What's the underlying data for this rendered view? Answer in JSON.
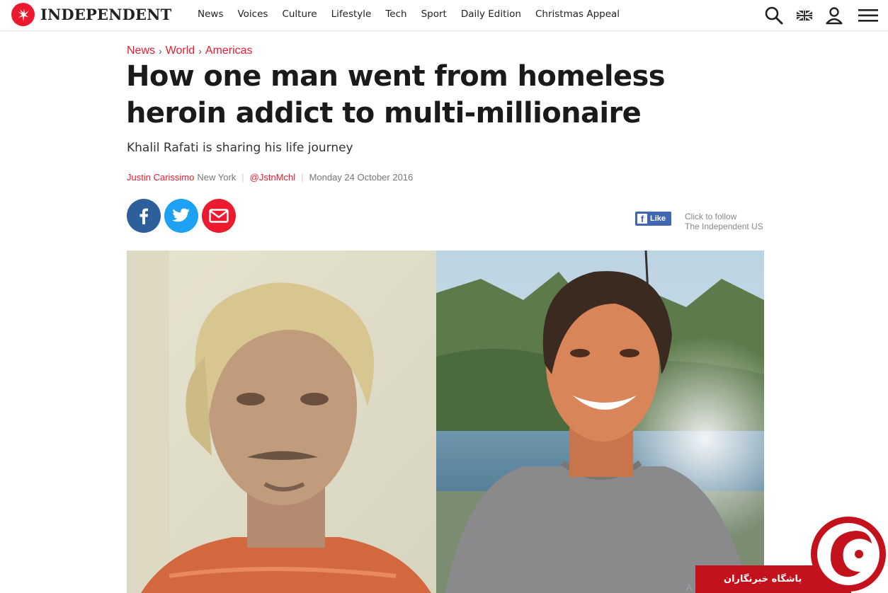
{
  "brand": {
    "name": "INDEPENDENT",
    "accent": "#ec1a2e"
  },
  "nav": [
    "News",
    "Voices",
    "Culture",
    "Lifestyle",
    "Tech",
    "Sport",
    "Daily Edition",
    "Christmas Appeal"
  ],
  "icons": [
    "search-icon",
    "uk-flag-icon",
    "user-icon",
    "menu-icon"
  ],
  "breadcrumb": [
    "News",
    "World",
    "Americas"
  ],
  "article": {
    "headline": "How one man went from homeless heroin addict to multi-millionaire",
    "standfirst": "Khalil Rafati is sharing his life journey",
    "author": "Justin Carissimo",
    "location": "New York",
    "twitter": "@JstnMchl",
    "date": "Monday 24 October 2016"
  },
  "social": {
    "like_label": "Like",
    "follow_line1": "Click to follow",
    "follow_line2": "The Independent US"
  },
  "watermark": {
    "text": "باشگاه خبرنگاران"
  }
}
